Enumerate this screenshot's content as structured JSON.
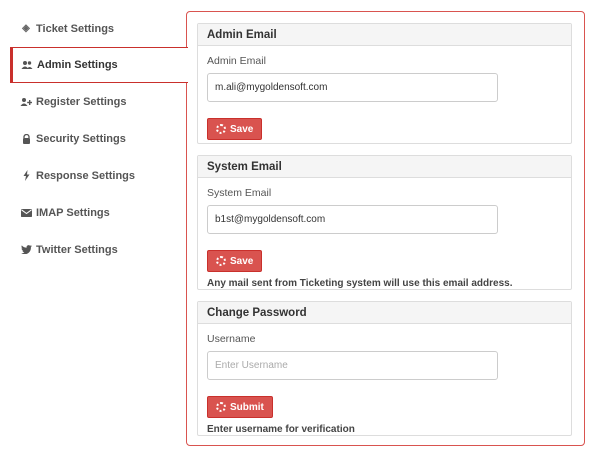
{
  "sidebar": {
    "items": [
      {
        "label": "Ticket Settings",
        "icon": "ticket-icon",
        "glyph": "◈"
      },
      {
        "label": "Admin Settings",
        "icon": "users-icon",
        "glyph": "👥"
      },
      {
        "label": "Register Settings",
        "icon": "user-plus-icon",
        "glyph": "➕"
      },
      {
        "label": "Security Settings",
        "icon": "lock-icon",
        "glyph": "🔒"
      },
      {
        "label": "Response Settings",
        "icon": "bolt-icon",
        "glyph": "⚡"
      },
      {
        "label": "IMAP Settings",
        "icon": "envelope-icon",
        "glyph": "✉"
      },
      {
        "label": "Twitter Settings",
        "icon": "twitter-icon",
        "glyph": "🐦"
      }
    ]
  },
  "admin_email": {
    "title": "Admin Email",
    "label": "Admin Email",
    "value": "m.ali@mygoldensoft.com",
    "button": "Save"
  },
  "system_email": {
    "title": "System Email",
    "label": "System Email",
    "value": "b1st@mygoldensoft.com",
    "button": "Save",
    "help": "Any mail sent from Ticketing system will use this email address."
  },
  "change_password": {
    "title": "Change Password",
    "label": "Username",
    "placeholder": "Enter Username",
    "button": "Submit",
    "help": "Enter username for verification"
  },
  "colors": {
    "accent": "#d9534f",
    "accent_border": "#c9302c",
    "panel_header": "#f5f5f5"
  }
}
